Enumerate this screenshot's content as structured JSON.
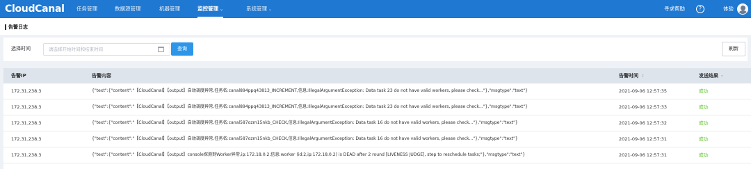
{
  "app": {
    "logo": "CloudCanal"
  },
  "nav": {
    "items": [
      {
        "label": "任务管理",
        "dropdown": false
      },
      {
        "label": "数据源管理",
        "dropdown": false
      },
      {
        "label": "机器管理",
        "dropdown": false
      },
      {
        "label": "监控管理",
        "dropdown": true,
        "active": true
      },
      {
        "label": "系统管理",
        "dropdown": true
      }
    ],
    "help_label": "寻求帮助",
    "help_icon": "question-circle-icon",
    "user_label": "体验",
    "avatar_icon": "user-avatar-icon"
  },
  "page": {
    "title": "告警日志"
  },
  "filter": {
    "label": "选择时间",
    "date_placeholder": "请选择开始时间和结束时间",
    "calendar_icon": "calendar-icon",
    "query_label": "查询",
    "refresh_label": "刷新"
  },
  "table": {
    "columns": [
      {
        "label": "告警IP"
      },
      {
        "label": "告警内容"
      },
      {
        "label": "告警时间",
        "sort_icon": "sort-icon"
      },
      {
        "label": "发送结果",
        "filter_icon": "filter-icon"
      }
    ],
    "rows": [
      {
        "ip": "172.31.238.3",
        "content": "{\"text\":{\"content\":\"【CloudCanal】【output】自动调度异常,任务名:canal894ppq43813_INCREMENT,信息:IllegalArgumentException: Data task 23 do not have valid workers, please check...\"},\"msgtype\":\"text\"}",
        "time": "2021-09-06 12:57:35",
        "result": "成功"
      },
      {
        "ip": "172.31.238.3",
        "content": "{\"text\":{\"content\":\"【CloudCanal】【output】自动调度异常,任务名:canal894ppq43813_INCREMENT,信息:IllegalArgumentException: Data task 23 do not have valid workers, please check...\"},\"msgtype\":\"text\"}",
        "time": "2021-09-06 12:57:33",
        "result": "成功"
      },
      {
        "ip": "172.31.238.3",
        "content": "{\"text\":{\"content\":\"【CloudCanal】【output】自动调度异常,任务名:canal587ozm15nkb_CHECK,信息:IllegalArgumentException: Data task 16 do not have valid workers, please check...\"},\"msgtype\":\"text\"}",
        "time": "2021-09-06 12:57:32",
        "result": "成功"
      },
      {
        "ip": "172.31.238.3",
        "content": "{\"text\":{\"content\":\"【CloudCanal】【output】自动调度异常,任务名:canal587ozm15nkb_CHECK,信息:IllegalArgumentException: Data task 16 do not have valid workers, please check...\"},\"msgtype\":\"text\"}",
        "time": "2021-09-06 12:57:31",
        "result": "成功"
      },
      {
        "ip": "172.31.238.3",
        "content": "{\"text\":{\"content\":\"【CloudCanal】【output】console探测到Worker异常,ip:172.18.0.2,信息:worker (id:2,ip:172.18.0.2) is DEAD after 2 round [LIVENESS JUDGE], step to reschedule tasks;\"},\"msgtype\":\"text\"}",
        "time": "2021-09-06 12:57:31",
        "result": "成功"
      }
    ]
  },
  "colors": {
    "topbar": "#1f78d1",
    "primary_button": "#2d96e8",
    "success": "#52c41a",
    "table_header": "#dde4ec"
  }
}
